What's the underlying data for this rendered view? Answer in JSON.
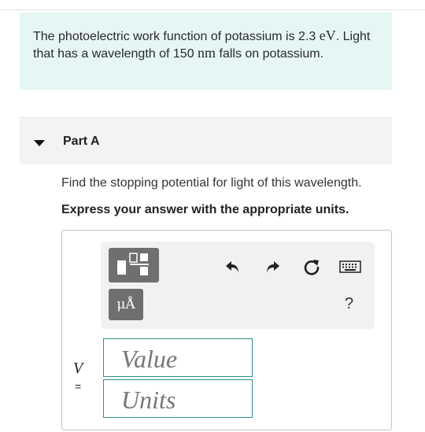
{
  "problem": {
    "text_before_eV": "The photoelectric work function of potassium is 2.3 ",
    "unit_eV": "eV",
    "text_after_eV": ". Light that has a wavelength of 150 ",
    "unit_nm": "nm",
    "text_after_nm": " falls on potassium."
  },
  "part": {
    "title": "Part A",
    "question": "Find the stopping potential for light of this wavelength.",
    "instruction": "Express your answer with the appropriate units."
  },
  "toolbar": {
    "templates_icon": "templates-icon",
    "units_label": "μÅ",
    "undo_icon": "undo-icon",
    "redo_icon": "redo-icon",
    "reset_icon": "reset-icon",
    "keyboard_icon": "keyboard-icon",
    "help_label": "?"
  },
  "answer": {
    "variable": "V",
    "equals": "=",
    "value_placeholder": "Value",
    "units_placeholder": "Units"
  },
  "colors": {
    "problem_bg": "#e6f6f5",
    "field_border": "#2f8f8b",
    "button_gray": "#6f6f6f"
  }
}
